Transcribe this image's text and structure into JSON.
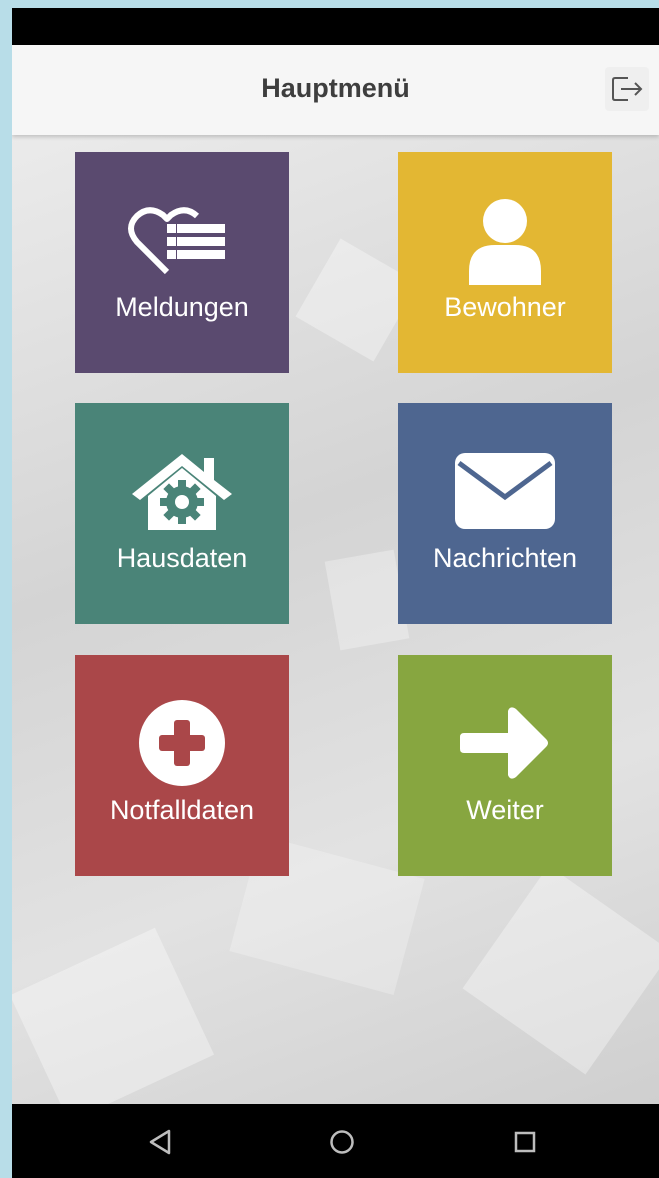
{
  "header": {
    "title": "Hauptmenü",
    "logout_icon": "logout-icon"
  },
  "tiles": [
    {
      "label": "Meldungen",
      "color": "#5a4a6f",
      "icon": "heart-list-icon"
    },
    {
      "label": "Bewohner",
      "color": "#e3b733",
      "icon": "person-icon"
    },
    {
      "label": "Hausdaten",
      "color": "#4a8478",
      "icon": "house-gear-icon"
    },
    {
      "label": "Nachrichten",
      "color": "#4e6690",
      "icon": "envelope-icon"
    },
    {
      "label": "Notfalldaten",
      "color": "#aa4749",
      "icon": "plus-circle-icon"
    },
    {
      "label": "Weiter",
      "color": "#87a640",
      "icon": "arrow-right-icon"
    }
  ],
  "navigation": {
    "back_icon": "back-triangle-icon",
    "home_icon": "home-circle-icon",
    "recents_icon": "recents-square-icon"
  }
}
